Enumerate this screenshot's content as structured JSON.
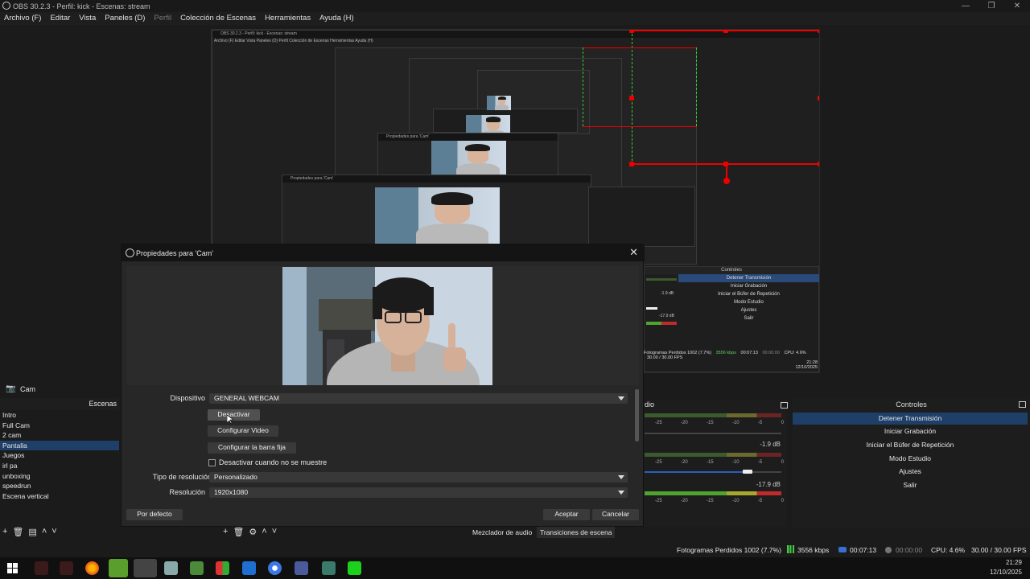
{
  "window": {
    "title": "OBS 30.2.3 - Perfil: kick - Escenas: stream"
  },
  "menu": [
    "Archivo (F)",
    "Editar",
    "Vista",
    "Paneles (D)",
    "Perfil",
    "Colección de Escenas",
    "Herramientas",
    "Ayuda (H)"
  ],
  "nested": {
    "title": "OBS 30.2.3 - Perfil: kick - Escenas: stream",
    "menu": "Archivo (F)   Editar   Vista   Paneles (D)   Perfil   Colección de Escenas   Herramientas   Ayuda (H)",
    "dialog2_title": "Propiedades para 'Cam'",
    "dialog3_title": "Propiedades para 'Cam'",
    "controls_header": "Controles",
    "controls": [
      "Detener Transmisión",
      "Iniciar Grabación",
      "Iniciar el Búfer de Repetición",
      "Modo Estudio",
      "Ajustes",
      "Salir"
    ],
    "db1": "-1.9 dB",
    "db2": "-17.9 dB",
    "status": {
      "dropped": "Fotogramas Perdidos 1002 (7.7%)",
      "kbps": "3556 kbps",
      "time": "00:07:13",
      "rec": "00:00:00",
      "cpu": "CPU: 4.6%",
      "fps": "30.00 / 30.00 FPS",
      "clock_time": "21:28",
      "clock_date": "12/10/2025"
    }
  },
  "dialog": {
    "title": "Propiedades para 'Cam'",
    "device_label": "Dispositivo",
    "device_value": "GENERAL WEBCAM",
    "btn_deactivate": "Desactivar",
    "btn_config_video": "Configurar Video",
    "btn_config_bar": "Configurar la barra fija",
    "chk_label": "Desactivar cuando no se muestre",
    "res_type_label": "Tipo de resolución/FPS",
    "res_type_value": "Personalizado",
    "res_label": "Resolución",
    "res_value": "1920x1080",
    "btn_default": "Por defecto",
    "btn_accept": "Aceptar",
    "btn_cancel": "Cancelar"
  },
  "source": {
    "name": "Cam"
  },
  "scenes": {
    "header": "Escenas",
    "items": [
      "Intro",
      "Full Cam",
      "2 cam",
      "Pantalla",
      "Juegos",
      "irl pa",
      "unboxing",
      "speedrun",
      "Escena vertical"
    ],
    "selected_index": 3
  },
  "mixer": {
    "header_fragment": "dio",
    "ticks": [
      "-25",
      "-20",
      "-15",
      "-10",
      "-5",
      "0"
    ],
    "db1": "-1.9 dB",
    "db2": "-17.9 dB",
    "slider1_level": 0.75,
    "slider2_level": 0.75
  },
  "controls": {
    "header": "Controles",
    "buttons": [
      "Detener Transmisión",
      "Iniciar Grabación",
      "Iniciar el Búfer de Repetición",
      "Modo Estudio",
      "Ajustes",
      "Salir"
    ],
    "active_index": 0
  },
  "tabs": {
    "mixer": "Mezclador de audio",
    "transitions": "Transiciones de escena"
  },
  "status": {
    "dropped": "Fotogramas Perdidos 1002 (7.7%)",
    "kbps": "3556 kbps",
    "stream_time": "00:07:13",
    "rec_time": "00:00:00",
    "cpu": "CPU: 4.6%",
    "fps": "30.00 / 30.00 FPS"
  },
  "clock": {
    "time": "21:29",
    "date": "12/10/2025"
  },
  "colors": {
    "accent": "#1d3f68",
    "selection_border": "#e00000",
    "guide": "#33cc33"
  }
}
